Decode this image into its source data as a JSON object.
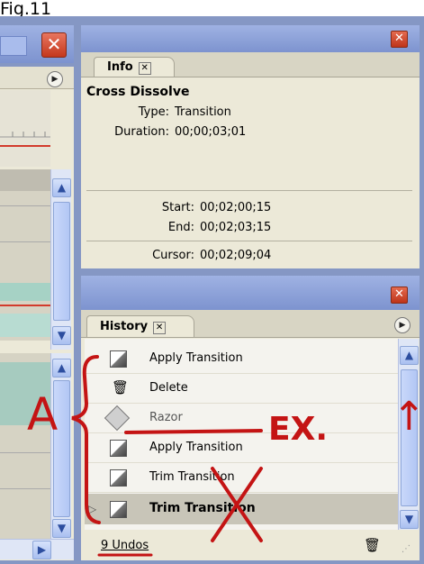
{
  "figure_label": "Fig.11",
  "info_panel": {
    "tab_label": "Info",
    "clip_name": "Cross Dissolve",
    "type_label": "Type:",
    "type_value": "Transition",
    "duration_label": "Duration:",
    "duration_value": "00;00;03;01",
    "start_label": "Start:",
    "start_value": "00;02;00;15",
    "end_label": "End:",
    "end_value": "00;02;03;15",
    "cursor_label": "Cursor:",
    "cursor_value": "00;02;09;04"
  },
  "history_panel": {
    "tab_label": "History",
    "items": [
      {
        "label": "Apply Transition",
        "icon": "transition-icon"
      },
      {
        "label": "Delete",
        "icon": "trash-icon"
      },
      {
        "label": "Razor",
        "icon": "razor-icon"
      },
      {
        "label": "Apply Transition",
        "icon": "transition-icon"
      },
      {
        "label": "Trim Transition",
        "icon": "transition-icon"
      },
      {
        "label": "Trim Transition",
        "icon": "transition-icon",
        "selected": true
      }
    ],
    "undo_count": "9 Undos"
  },
  "annotations": {
    "mark_a": "A",
    "mark_ex": "EX.",
    "mark_x": "X",
    "arrow": "↑"
  },
  "colors": {
    "desktop": "#8597c4",
    "panel": "#ece9d8",
    "annotation_red": "#c41414",
    "close_red": "#c4381d"
  }
}
